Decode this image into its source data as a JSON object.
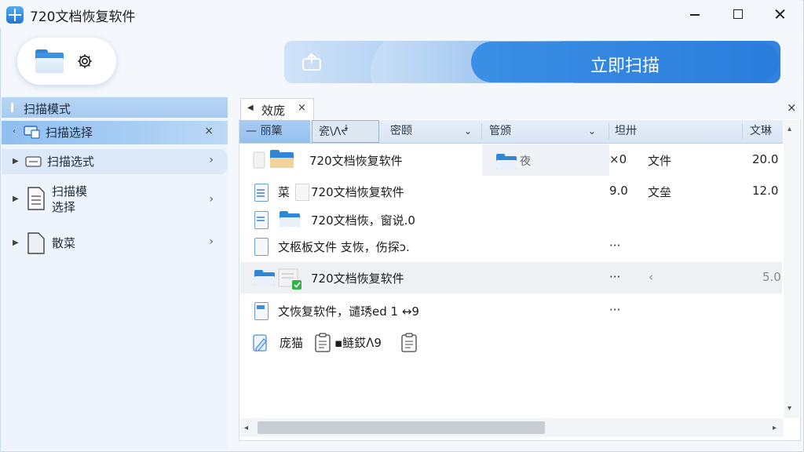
{
  "window": {
    "title": "720文档恢复软件"
  },
  "toolbar": {
    "scan_button": "立即扫描"
  },
  "sidebar": {
    "header": "扫描模式",
    "items": [
      {
        "label": "扫描选择",
        "suffix": "×"
      },
      {
        "label": "扫描选式",
        "suffix": "›"
      },
      {
        "label": "扫描模\n选择",
        "suffix": "›"
      },
      {
        "label": "散菜",
        "suffix": "›"
      }
    ]
  },
  "tab": {
    "label": "效庞",
    "close": "×"
  },
  "panel_close": "×",
  "columns": [
    "— 丽篥",
    "瓷\\ᐱᖫ",
    "密颐",
    "管颁",
    "坦卅",
    "文琳"
  ],
  "rows": [
    {
      "name": "720文档恢复软件",
      "grey": "夜",
      "c1": "×0",
      "c2": "文件",
      "c3": "20.0"
    },
    {
      "prefix": "菜",
      "name": "720文档恢复软件",
      "c1": "9.0",
      "c2": "文垒",
      "c3": "12.0"
    },
    {
      "name": "720文档恢，窗说.0"
    },
    {
      "name": "文柩板文件 支恢，伤探ɔ.",
      "c1": "···"
    },
    {
      "name": "720文档恢复软件",
      "c1": "···",
      "c2": "‹",
      "c3": "5.0"
    },
    {
      "name": "文恢复软件，谴琇ed 1 ↔9",
      "c1": "···"
    },
    {
      "prefix": "庞猫",
      "name": "▪鲢銰ᐱ9"
    }
  ],
  "scroll": {
    "left": "◂",
    "right": "▸"
  }
}
